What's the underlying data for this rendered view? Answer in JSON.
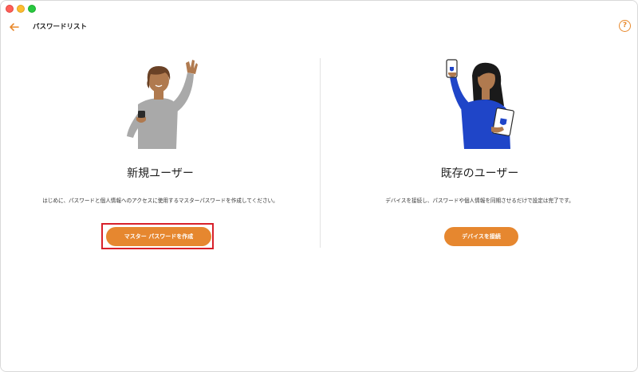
{
  "header": {
    "title": "パスワードリスト",
    "help_label": "?"
  },
  "new_user": {
    "heading": "新規ユーザー",
    "description": "はじめに、パスワードと個人情報へのアクセスに使用するマスターパスワードを作成してください。",
    "button_label": "マスター パスワードを作成"
  },
  "existing_user": {
    "heading": "既存のユーザー",
    "description": "デバイスを接続し、パスワードや個人情報を同期させるだけで設定は完了です。",
    "button_label": "デバイスを接続"
  },
  "colors": {
    "accent": "#e6872f",
    "highlight": "#d8202a",
    "shirt_gray": "#a9a9a9",
    "shirt_blue": "#1f45c8"
  }
}
